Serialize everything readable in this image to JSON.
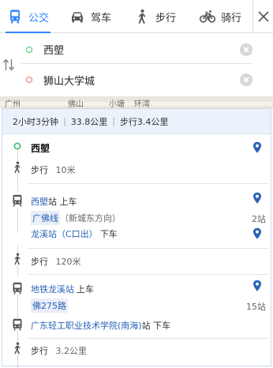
{
  "tabs": [
    {
      "label": "公交",
      "icon": "bus-icon",
      "active": true
    },
    {
      "label": "驾车",
      "icon": "car-icon",
      "active": false
    },
    {
      "label": "步行",
      "icon": "walk-icon",
      "active": false
    },
    {
      "label": "骑行",
      "icon": "bicycle-icon",
      "active": false
    }
  ],
  "route": {
    "origin": "西塱",
    "destination": "狮山大学城"
  },
  "map_labels": [
    "广州",
    "佛山",
    "小塘",
    "环湾"
  ],
  "summary": {
    "duration": "2小时3分钟",
    "distance": "33.8公里",
    "walk": "步行3.4公里"
  },
  "steps": {
    "start_name": "西塱",
    "walk1": "步行",
    "walk1_dist": "10米",
    "board1_station": "西塱",
    "board1_suffix": "站 上车",
    "line1_name": "广佛线",
    "line1_dir": "（新城东方向）",
    "line1_stops": "2站",
    "alight1_station": "龙溪站（C口出）",
    "alight1_suffix": "下车",
    "walk2": "步行",
    "walk2_dist": "120米",
    "board2_station": "地铁龙溪站",
    "board2_suffix": "上车",
    "line2_name": "佛275路",
    "line2_stops": "15站",
    "alight2_station": "广东轻工职业技术学院(南海)",
    "alight2_suffix": "站 下车",
    "walk3": "步行",
    "walk3_dist": "3.2公里"
  },
  "colors": {
    "accent": "#3385ff",
    "link": "#2a63b8",
    "origin_dot": "#49c36e",
    "dest_dot": "#ee6b6b"
  }
}
